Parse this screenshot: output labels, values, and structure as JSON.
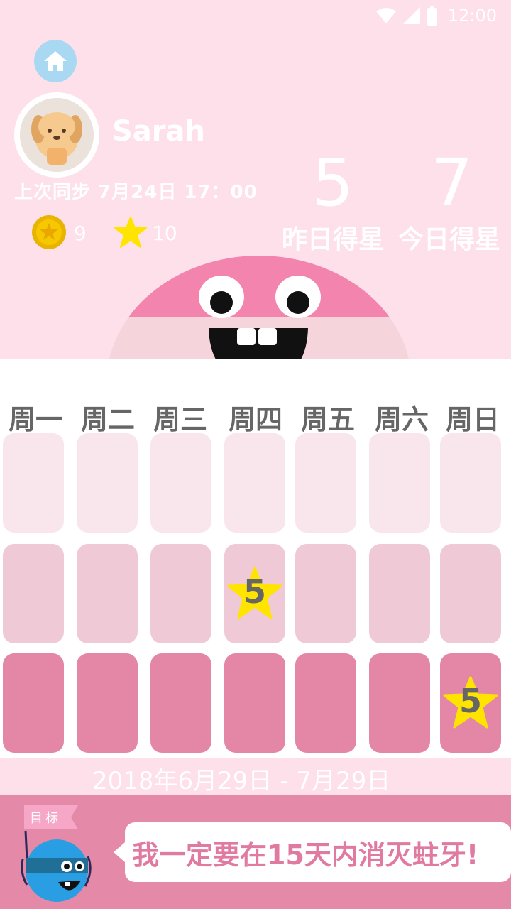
{
  "status_bar": {
    "time": "12:00",
    "icons": [
      "wifi-icon",
      "signal-icon",
      "battery-icon"
    ]
  },
  "header": {
    "home_icon": "home-icon"
  },
  "profile": {
    "name": "Sarah",
    "last_sync": "上次同步 7月24日 17：00",
    "coins": "9",
    "stars": "10"
  },
  "stats": {
    "yesterday_value": "5",
    "yesterday_label": "昨日得星",
    "today_value": "7",
    "today_label": "今日得星"
  },
  "weekdays": [
    "周一",
    "周二",
    "周三",
    "周四",
    "周五",
    "周六",
    "周日"
  ],
  "calendar": {
    "rows": [
      [
        "",
        "",
        "",
        "",
        "",
        "",
        ""
      ],
      [
        "",
        "",
        "",
        "5",
        "",
        "",
        ""
      ],
      [
        "",
        "",
        "",
        "",
        "",
        "",
        "5"
      ]
    ]
  },
  "date_range": "2018年6月29日 - 7月29日",
  "goal": {
    "flag_label": "目标",
    "text": "我一定要在15天内消灭蛀牙!"
  },
  "colors": {
    "background": "#fde0ea",
    "row1": "#f9e6ec",
    "row2": "#f0c9d7",
    "row3": "#e487a7",
    "goal_bar": "#e489a8",
    "accent_pink": "#f384ae",
    "star_yellow": "#ffe400"
  }
}
